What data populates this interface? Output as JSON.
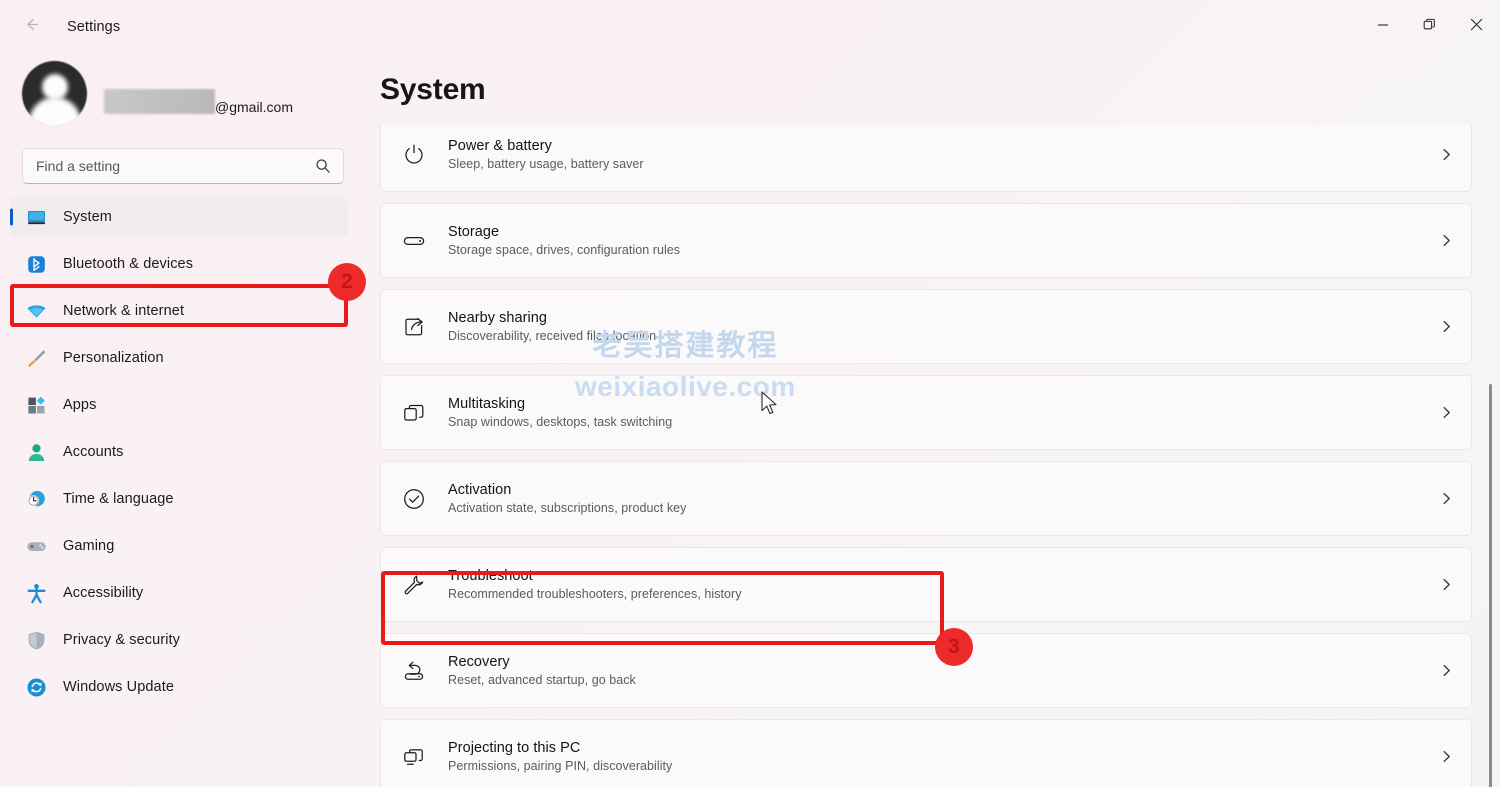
{
  "window": {
    "app_title": "Settings",
    "back_icon": "arrow-left-icon",
    "controls": [
      {
        "name": "minimize-button",
        "glyph": "minimize-icon"
      },
      {
        "name": "maximize-button",
        "glyph": "restore-icon"
      },
      {
        "name": "close-button",
        "glyph": "close-icon"
      }
    ]
  },
  "account": {
    "avatar_icon": "default-account-avatar",
    "name_redacted": "",
    "email_domain": "@gmail.com"
  },
  "search": {
    "placeholder": "Find a setting",
    "value": "",
    "icon": "search-icon"
  },
  "sidebar": {
    "items": [
      {
        "label": "System",
        "icon": "monitor-icon",
        "selected": true
      },
      {
        "label": "Bluetooth & devices",
        "icon": "bluetooth-icon",
        "selected": false
      },
      {
        "label": "Network & internet",
        "icon": "wifi-icon",
        "selected": false
      },
      {
        "label": "Personalization",
        "icon": "paintbrush-icon",
        "selected": false
      },
      {
        "label": "Apps",
        "icon": "apps-grid-icon",
        "selected": false
      },
      {
        "label": "Accounts",
        "icon": "person-icon",
        "selected": false
      },
      {
        "label": "Time & language",
        "icon": "clock-globe-icon",
        "selected": false
      },
      {
        "label": "Gaming",
        "icon": "gamepad-icon",
        "selected": false
      },
      {
        "label": "Accessibility",
        "icon": "accessibility-person-icon",
        "selected": false
      },
      {
        "label": "Privacy & security",
        "icon": "shield-icon",
        "selected": false
      },
      {
        "label": "Windows Update",
        "icon": "sync-refresh-icon",
        "selected": false
      }
    ]
  },
  "main": {
    "page_title": "System",
    "chevron_icon": "chevron-right-icon",
    "cards": [
      {
        "title": "Power & battery",
        "subtitle": "Sleep, battery usage, battery saver",
        "icon": "power-icon"
      },
      {
        "title": "Storage",
        "subtitle": "Storage space, drives, configuration rules",
        "icon": "storage-drive-icon"
      },
      {
        "title": "Nearby sharing",
        "subtitle": "Discoverability, received files location",
        "icon": "share-icon"
      },
      {
        "title": "Multitasking",
        "subtitle": "Snap windows, desktops, task switching",
        "icon": "windows-stack-icon"
      },
      {
        "title": "Activation",
        "subtitle": "Activation state, subscriptions, product key",
        "icon": "check-circle-icon"
      },
      {
        "title": "Troubleshoot",
        "subtitle": "Recommended troubleshooters, preferences, history",
        "icon": "wrench-icon"
      },
      {
        "title": "Recovery",
        "subtitle": "Reset, advanced startup, go back",
        "icon": "recovery-arrow-icon"
      },
      {
        "title": "Projecting to this PC",
        "subtitle": "Permissions, pairing PIN, discoverability",
        "icon": "project-screen-icon"
      }
    ]
  },
  "annotations": {
    "badges": [
      {
        "label": "2",
        "target": "sidebar-item-system"
      },
      {
        "label": "3",
        "target": "card-troubleshoot"
      }
    ],
    "highlight_color": "#e81a1a",
    "badge_color": "#ee2b2b"
  },
  "watermark": {
    "line1": "老吴搭建教程",
    "line2": "weixiaolive.com",
    "color": "#c6daf0"
  },
  "theme": {
    "window_background": "#faf0f3",
    "card_background": "#fbf9fa",
    "accent": "#0d5ec1",
    "text_primary": "#151415",
    "text_secondary": "#5f5a5c"
  }
}
